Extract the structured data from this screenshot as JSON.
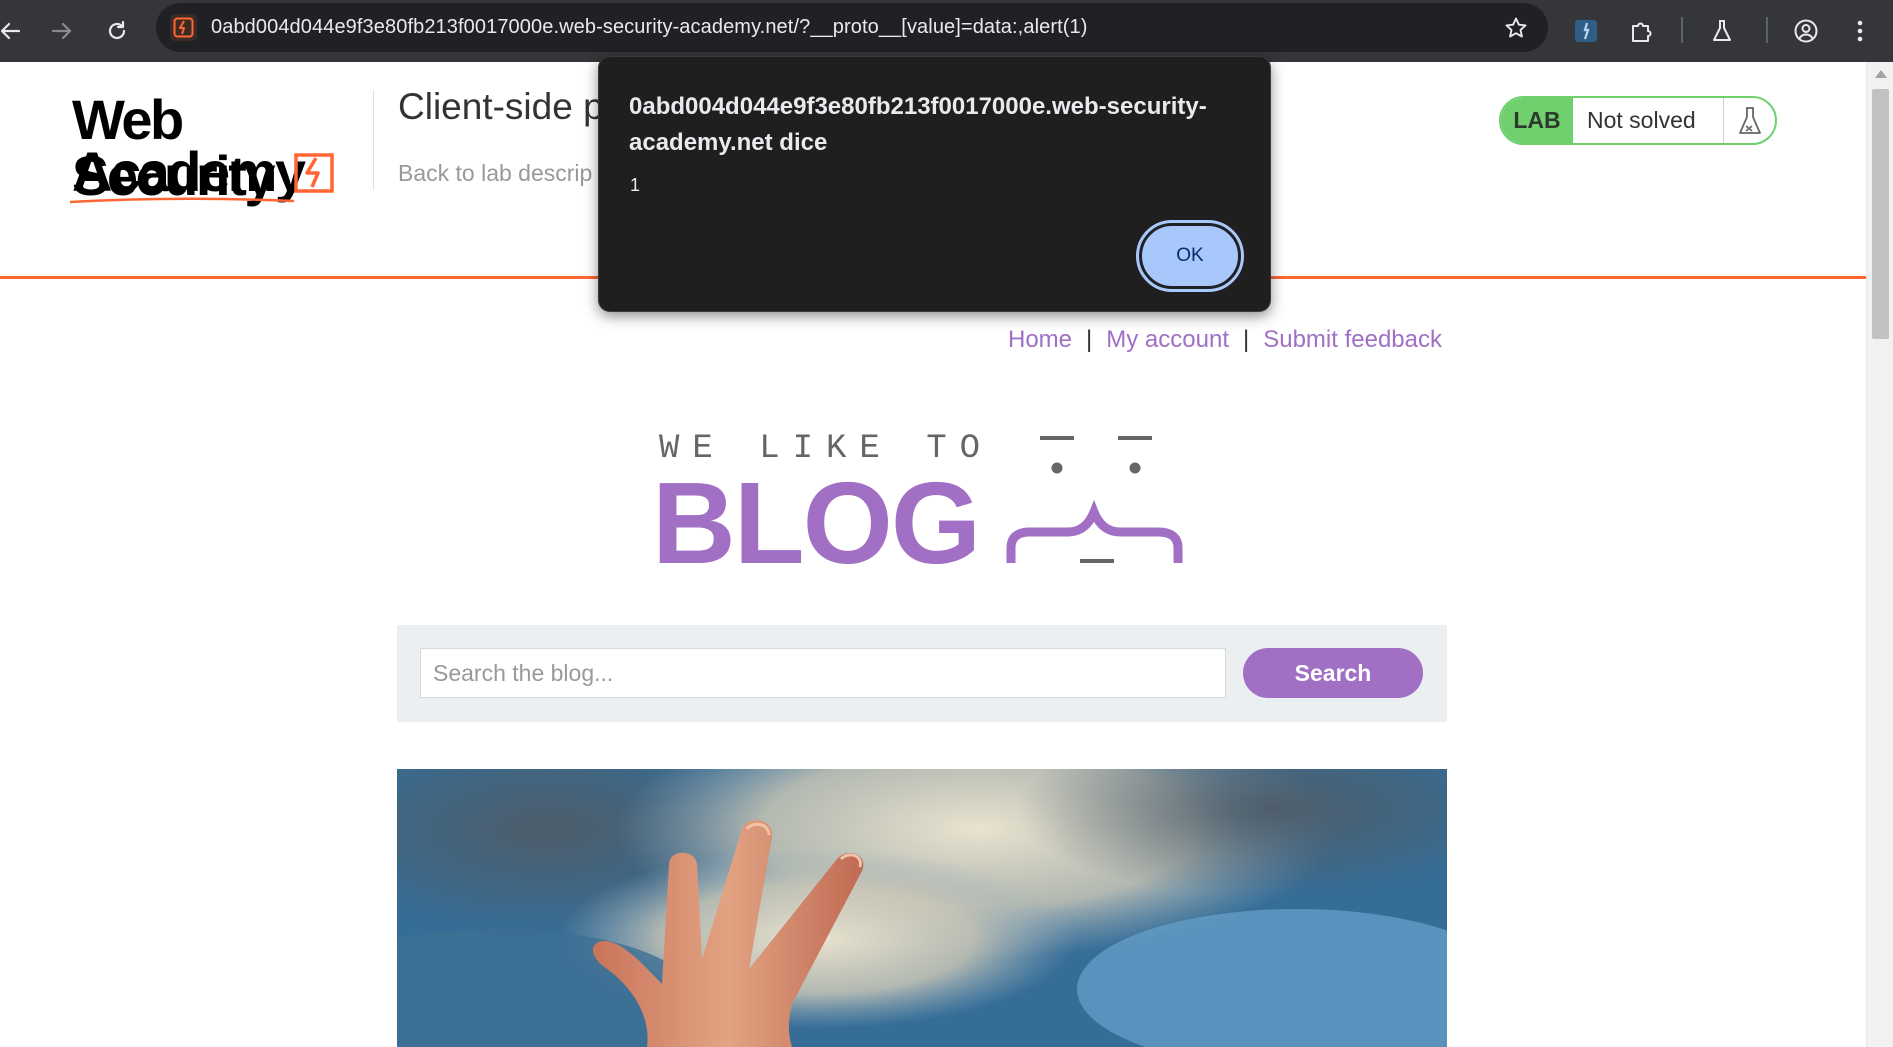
{
  "browser": {
    "url": "0abd004d044e9f3e80fb213f0017000e.web-security-academy.net/?__proto__[value]=data:,alert(1)"
  },
  "academy": {
    "logo_line1": "Web Security",
    "logo_line2": "Academy",
    "lab_title": "Client-side p",
    "back_link": "Back to lab descrip",
    "lab_tag": "LAB",
    "lab_status": "Not solved"
  },
  "blog": {
    "nav": {
      "home": "Home",
      "my_account": "My account",
      "submit_feedback": "Submit feedback",
      "separator": "|"
    },
    "tagline": "WE LIKE TO",
    "logo_word": "BLOG",
    "search": {
      "placeholder": "Search the blog...",
      "button": "Search"
    }
  },
  "dialog": {
    "title": "0abd004d044e9f3e80fb213f0017000e.web-security-academy.net dice",
    "message": "1",
    "ok_label": "OK"
  },
  "colors": {
    "accent_orange": "#ff6633",
    "blog_purple": "#a16fc4",
    "lab_green": "#70d06e",
    "chrome_dark": "#35363a",
    "dialog_bg": "#1f1f1f",
    "ok_button": "#a8c7fa"
  }
}
